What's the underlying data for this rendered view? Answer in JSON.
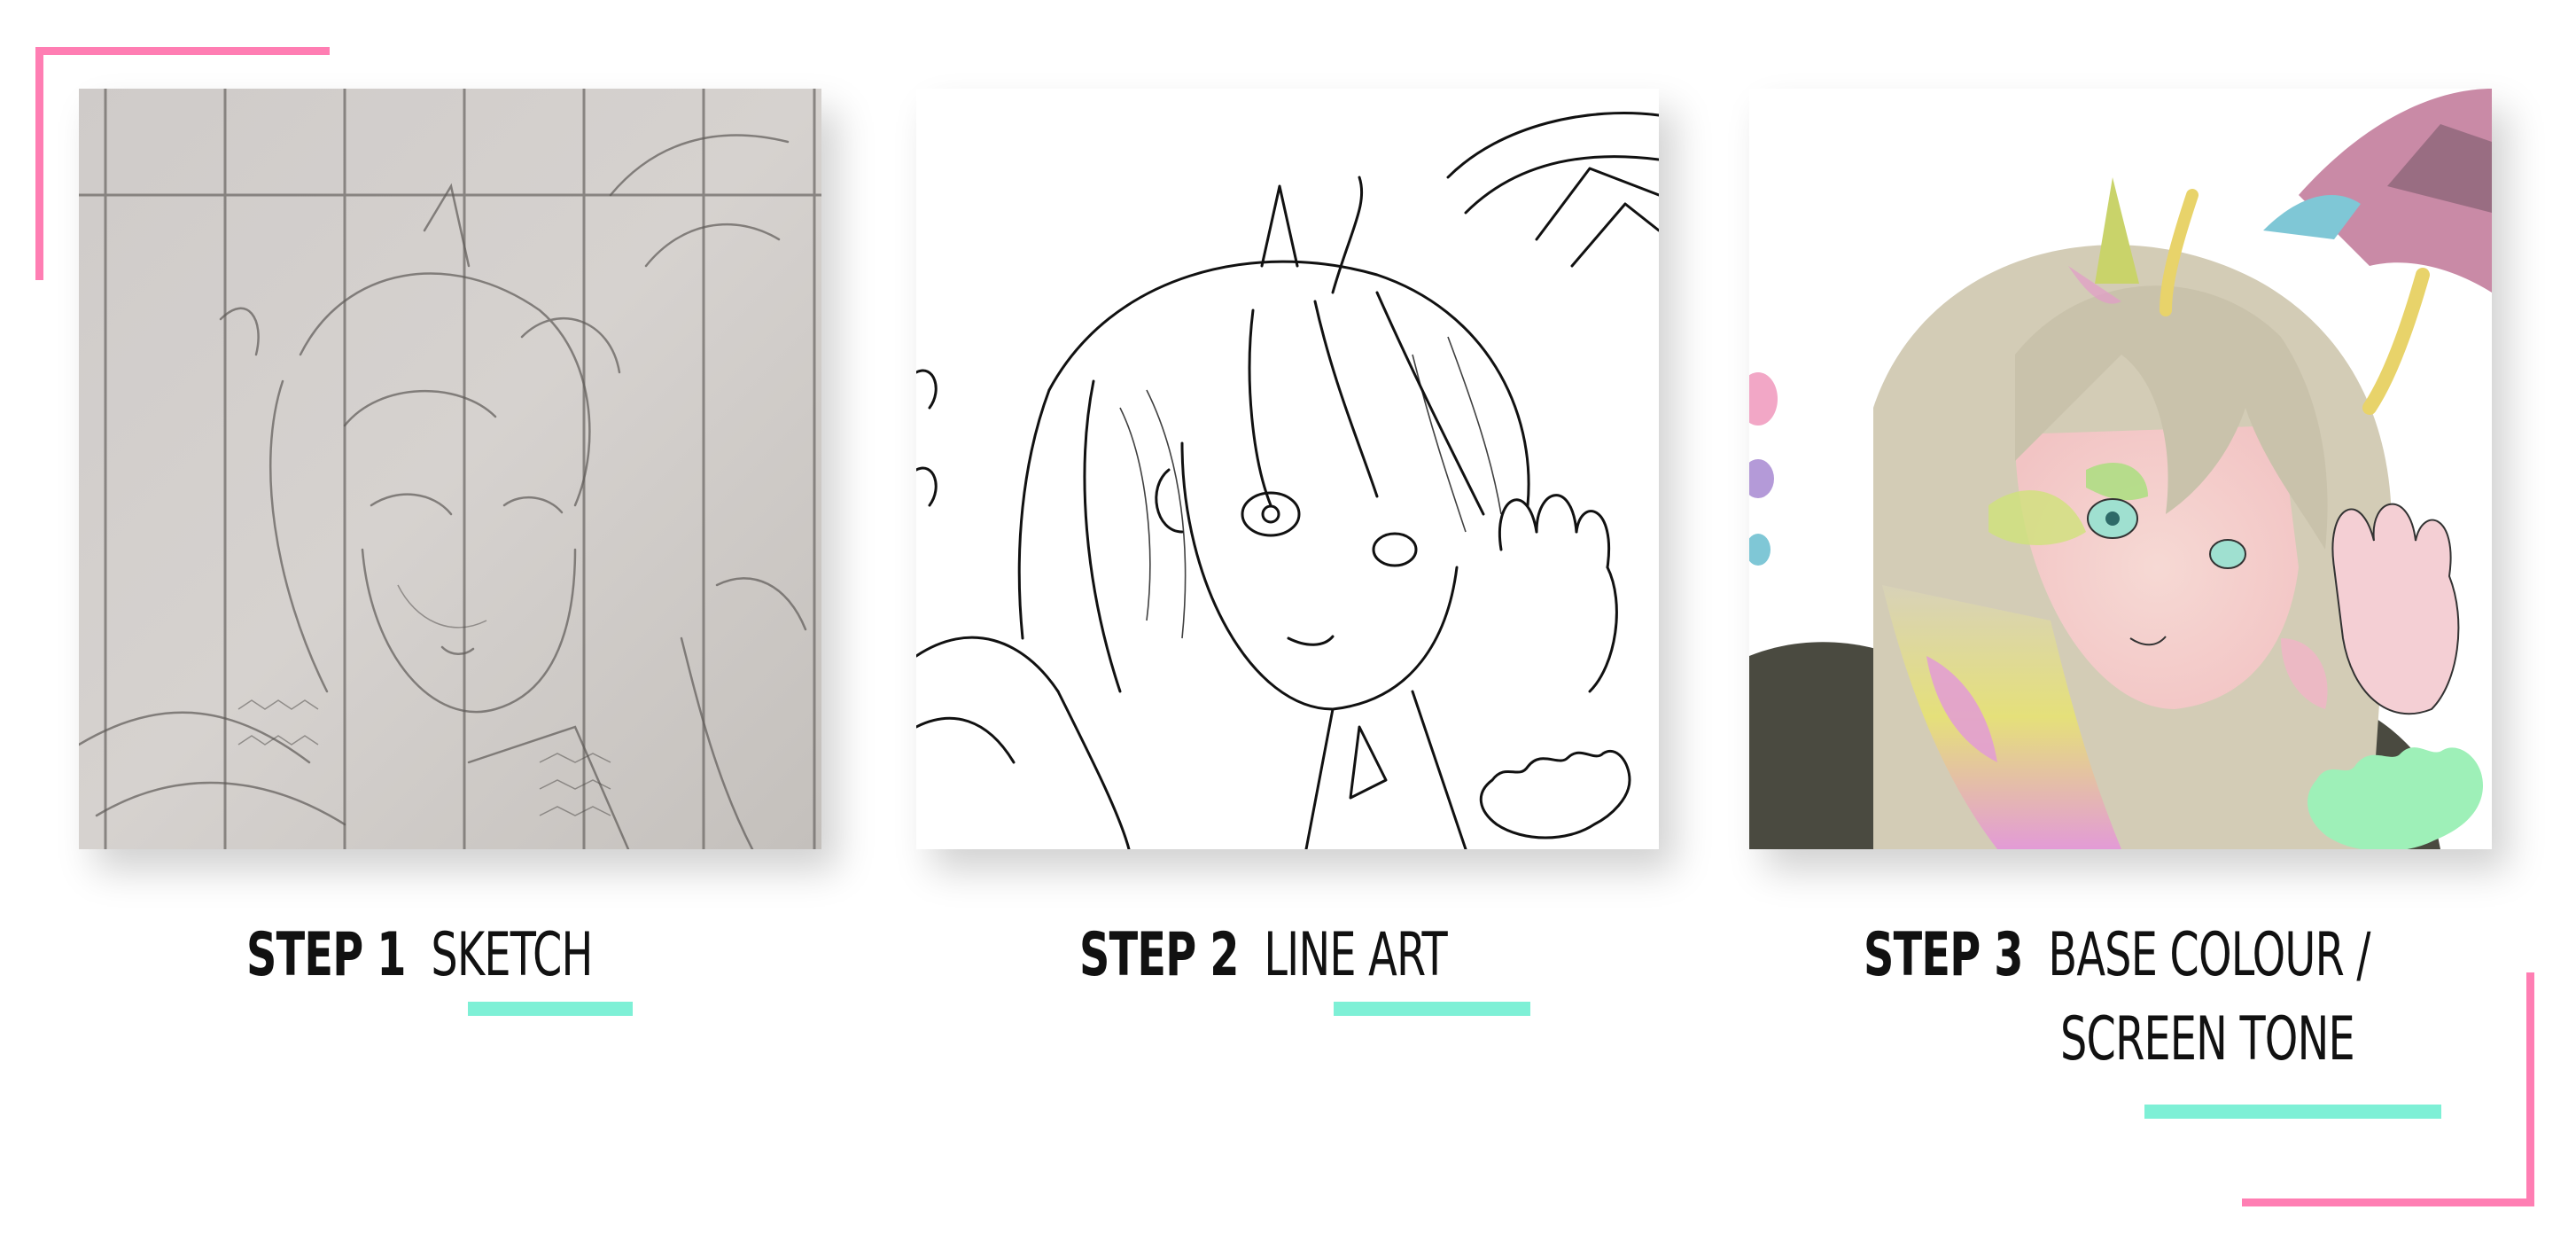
{
  "accents": {
    "corner_color": "#ff7eb3",
    "underline_color": "#7ef0d6"
  },
  "steps": [
    {
      "step": "STEP 1",
      "label": "SKETCH",
      "image": "pencil-sketch-illustration"
    },
    {
      "step": "STEP 2",
      "label": "LINE ART",
      "image": "line-art-illustration"
    },
    {
      "step": "STEP 3",
      "label": "BASE COLOUR /",
      "label_line2": "SCREEN TONE",
      "image": "base-colour-illustration"
    }
  ]
}
